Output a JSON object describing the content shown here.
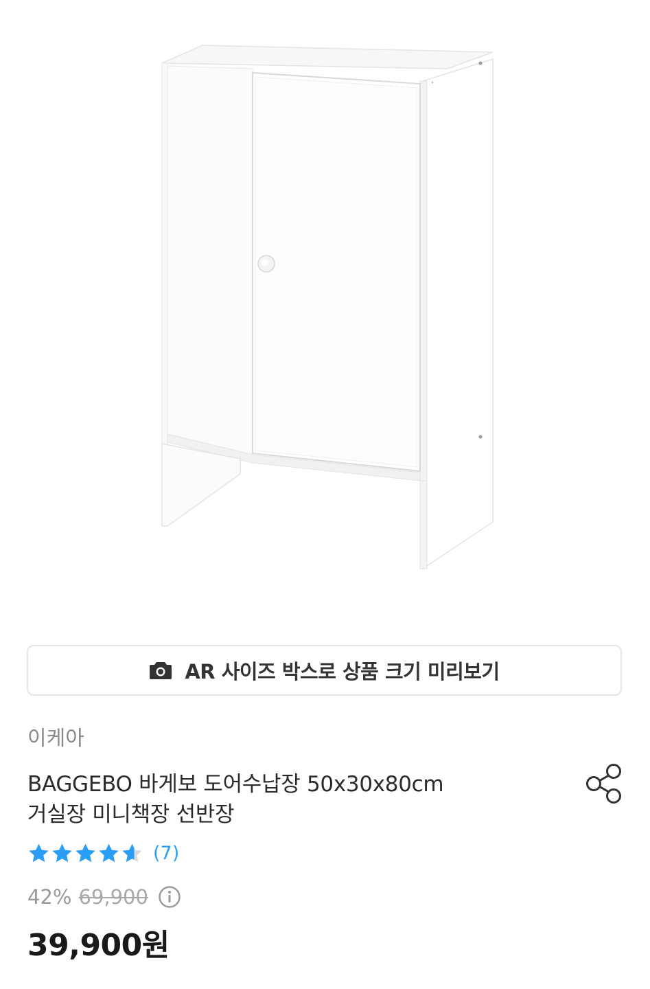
{
  "product": {
    "image": {
      "alt": "BAGGEBO 바게보 도어수납장 흰색 캐비닛",
      "color": "#ffffff"
    },
    "ar_button": {
      "icon": "camera-icon",
      "label": "AR 사이즈 박스로 상품 크기 미리보기"
    },
    "brand": "이케아",
    "title_line1": "BAGGEBO 바게보 도어수납장 50x30x80cm",
    "title_line2": "거실장 미니책장 선반장",
    "share_icon": "share-icon",
    "rating": {
      "value": 4.5,
      "max": 5,
      "count_label": "(7)",
      "star_color": "#2a9df4"
    },
    "discount_rate": "42%",
    "original_price": "69,900",
    "info_icon": "info-icon",
    "price": "39,900원"
  }
}
